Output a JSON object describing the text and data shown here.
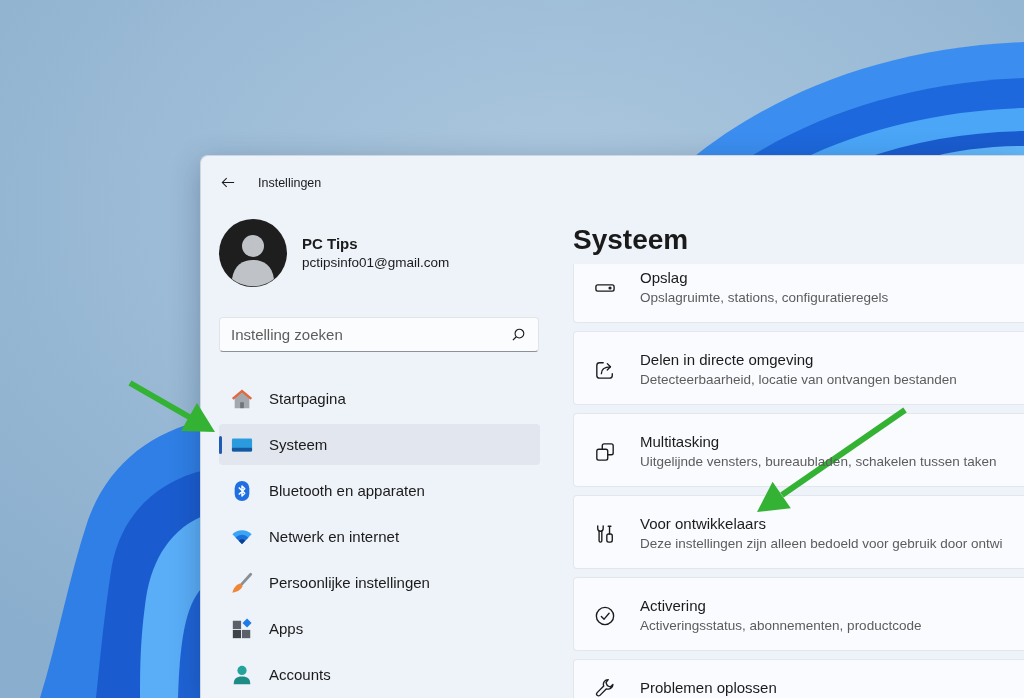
{
  "window": {
    "title": "Instellingen"
  },
  "profile": {
    "name": "PC Tips",
    "email": "pctipsinfo01@gmail.com"
  },
  "search": {
    "placeholder": "Instelling zoeken"
  },
  "sidebar": {
    "items": [
      {
        "label": "Startpagina",
        "selected": false
      },
      {
        "label": "Systeem",
        "selected": true
      },
      {
        "label": "Bluetooth en apparaten",
        "selected": false
      },
      {
        "label": "Netwerk en internet",
        "selected": false
      },
      {
        "label": "Persoonlijke instellingen",
        "selected": false
      },
      {
        "label": "Apps",
        "selected": false
      },
      {
        "label": "Accounts",
        "selected": false
      }
    ]
  },
  "page": {
    "title": "Systeem",
    "cards": [
      {
        "title": "Opslag",
        "subtitle": "Opslagruimte, stations, configuratieregels"
      },
      {
        "title": "Delen in directe omgeving",
        "subtitle": "Detecteerbaarheid, locatie van ontvangen bestanden"
      },
      {
        "title": "Multitasking",
        "subtitle": "Uitgelijnde vensters, bureaubladen, schakelen tussen taken"
      },
      {
        "title": "Voor ontwikkelaars",
        "subtitle": "Deze instellingen zijn alleen bedoeld voor gebruik door ontwi"
      },
      {
        "title": "Activering",
        "subtitle": "Activeringsstatus, abonnementen, productcode"
      },
      {
        "title": "Problemen oplossen"
      }
    ]
  },
  "annotations": [
    {
      "kind": "arrow"
    },
    {
      "kind": "arrow"
    }
  ]
}
